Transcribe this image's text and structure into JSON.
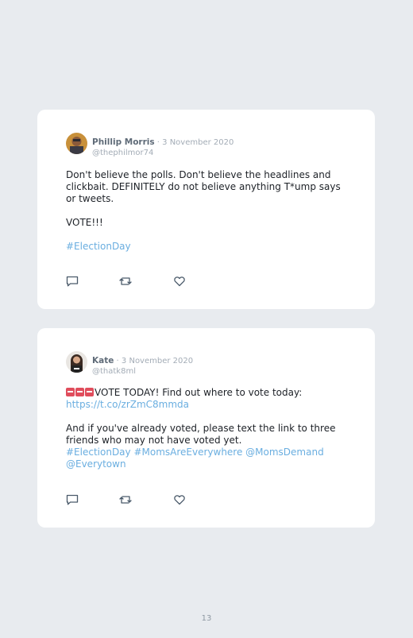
{
  "tweets": [
    {
      "author": "Phillip Morris",
      "separator": " · ",
      "date": "3 November 2020",
      "handle": "@thephilmor74",
      "paragraph1": "Don't believe the polls. Don't believe the headlines and clickbait. DEFINITELY do not believe anything T*ump says or tweets.",
      "paragraph2": "VOTE!!!",
      "hashtag": "#ElectionDay"
    },
    {
      "author": "Kate",
      "separator": " · ",
      "date": "3 November 2020",
      "handle": "@thatk8ml",
      "line1": "VOTE TODAY! Find out where to vote today:",
      "link": "https://t.co/zrZmC8mmda",
      "paragraph2": "And if you've already voted, please text the link to three friends who may not have voted yet.",
      "tags": "#ElectionDay #MomsAreEverywhere @MomsDemand @Everytown"
    }
  ],
  "icons": [
    "reply-icon",
    "retweet-icon",
    "like-icon"
  ],
  "page_number": "13",
  "colors": {
    "background": "#e8ebef",
    "card": "#ffffff",
    "link": "#6aaee0",
    "name": "#5f6b78",
    "muted": "#a3acb6",
    "icon": "#4a5a6a"
  }
}
